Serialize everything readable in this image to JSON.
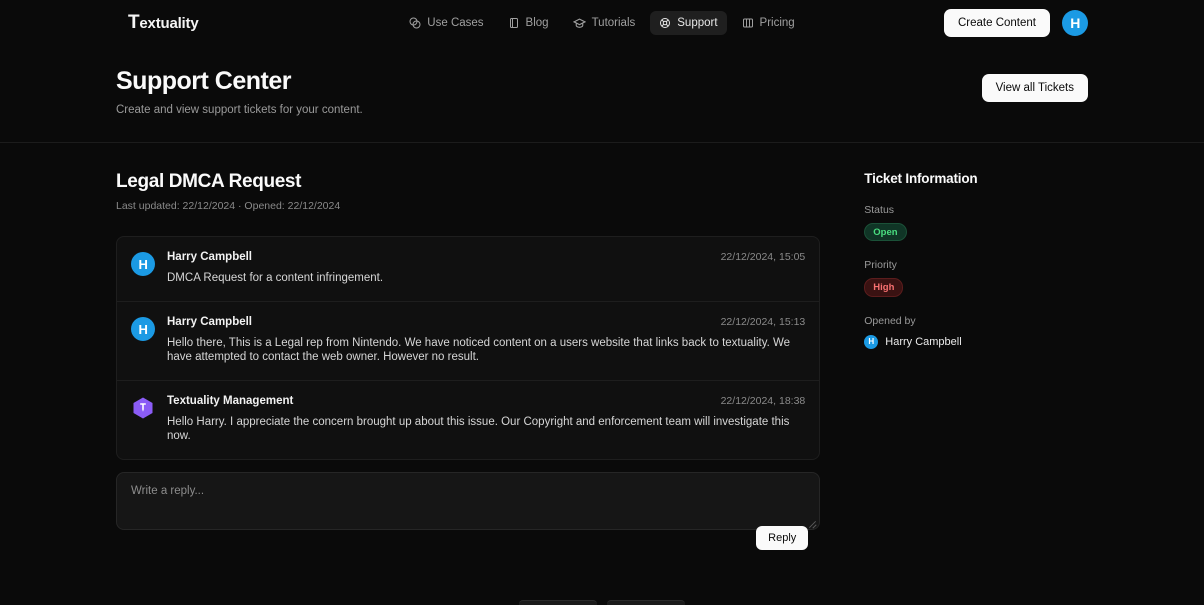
{
  "brand": {
    "cap": "T",
    "rest": "extuality"
  },
  "nav": {
    "items": [
      {
        "label": "Use Cases",
        "icon": "blend-icon",
        "active": false
      },
      {
        "label": "Blog",
        "icon": "book-icon",
        "active": false
      },
      {
        "label": "Tutorials",
        "icon": "graduation-cap-icon",
        "active": false
      },
      {
        "label": "Support",
        "icon": "lifebuoy-icon",
        "active": true
      },
      {
        "label": "Pricing",
        "icon": "columns-icon",
        "active": false
      }
    ],
    "create_content_label": "Create Content",
    "avatar_initial": "H"
  },
  "page_header": {
    "title": "Support Center",
    "subtitle": "Create and view support tickets for your content.",
    "view_all_label": "View all Tickets"
  },
  "ticket": {
    "title": "Legal DMCA Request",
    "meta": "Last updated: 22/12/2024 · Opened: 22/12/2024",
    "messages": [
      {
        "author": "Harry Campbell",
        "avatar": "H",
        "avatar_type": "circle",
        "time": "22/12/2024, 15:05",
        "text": "DMCA Request for a content infringement."
      },
      {
        "author": "Harry Campbell",
        "avatar": "H",
        "avatar_type": "circle",
        "time": "22/12/2024, 15:13",
        "text": "Hello there, This is a Legal rep from Nintendo. We have noticed content on a users website that links back to textuality. We have attempted to contact the web owner. However no result."
      },
      {
        "author": "Textuality Management",
        "avatar": "T",
        "avatar_type": "hexagon",
        "time": "22/12/2024, 18:38",
        "text": "Hello Harry. I appreciate the concern brought up about this issue. Our Copyright and enforcement team will investigate this now."
      }
    ],
    "reply_placeholder": "Write a reply...",
    "reply_value": "",
    "reply_button_label": "Reply"
  },
  "sidebar": {
    "title": "Ticket Information",
    "status_label": "Status",
    "status_value": "Open",
    "priority_label": "Priority",
    "priority_value": "High",
    "opened_by_label": "Opened by",
    "opened_by_name": "Harry Campbell",
    "opened_by_initial": "H"
  },
  "colors": {
    "page_bg": "#0a0a0a",
    "card_bg": "#101010",
    "accent_blue": "#1b9ae4",
    "accent_purple": "#8b5cf6",
    "status_green": "#4ade80",
    "priority_red": "#f87171"
  }
}
